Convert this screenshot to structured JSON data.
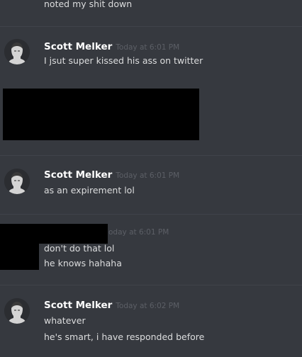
{
  "messages": [
    {
      "continuation": "noted my shit down"
    },
    {
      "author": "Scott Melker",
      "timestamp": "Today at 6:01 PM",
      "lines": [
        "I jsut super kissed his ass on twitter"
      ]
    },
    {
      "author": "Scott Melker",
      "timestamp": "Today at 6:01 PM",
      "lines": [
        "as an expirement lol"
      ]
    },
    {
      "timestamp_visible": "oday at 6:01 PM",
      "lines": [
        "don't do that lol",
        "he knows hahaha"
      ]
    },
    {
      "author": "Scott Melker",
      "timestamp": "Today at 6:02 PM",
      "lines": [
        "whatever",
        "he's smart, i have responded before"
      ]
    }
  ],
  "icons": {
    "avatar": "user-avatar-icon"
  },
  "colors": {
    "background": "#36393f",
    "author": "#ffffff",
    "message_text": "#dcddde",
    "timestamp": "#5c5f66",
    "divider": "#40434a",
    "redaction": "#000000"
  }
}
